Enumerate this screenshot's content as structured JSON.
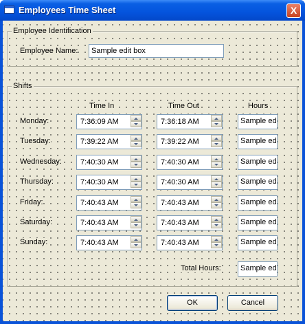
{
  "window": {
    "title": "Employees Time Sheet",
    "close_label": "X"
  },
  "identification": {
    "legend": "Employee Identification",
    "name_label": "Employee Name:",
    "name_value": "Sample edit box"
  },
  "shifts": {
    "legend": "Shifts",
    "col_time_in": "Time In",
    "col_time_out": "Time Out",
    "col_hours": "Hours",
    "days": [
      {
        "day": "Monday:",
        "time_in": "7:36:09 AM",
        "time_out": "7:36:18 AM",
        "hours": "Sample ed"
      },
      {
        "day": "Tuesday:",
        "time_in": "7:39:22 AM",
        "time_out": "7:39:22 AM",
        "hours": "Sample ed"
      },
      {
        "day": "Wednesday:",
        "time_in": "7:40:30 AM",
        "time_out": "7:40:30 AM",
        "hours": "Sample ed"
      },
      {
        "day": "Thursday:",
        "time_in": "7:40:30 AM",
        "time_out": "7:40:30 AM",
        "hours": "Sample ed"
      },
      {
        "day": "Friday:",
        "time_in": "7:40:43 AM",
        "time_out": "7:40:43 AM",
        "hours": "Sample ed"
      },
      {
        "day": "Saturday:",
        "time_in": "7:40:43 AM",
        "time_out": "7:40:43 AM",
        "hours": "Sample ed"
      },
      {
        "day": "Sunday:",
        "time_in": "7:40:43 AM",
        "time_out": "7:40:43 AM",
        "hours": "Sample ed"
      }
    ],
    "total_label": "Total Hours:",
    "total_value": "Sample ed"
  },
  "buttons": {
    "ok": "OK",
    "cancel": "Cancel"
  }
}
